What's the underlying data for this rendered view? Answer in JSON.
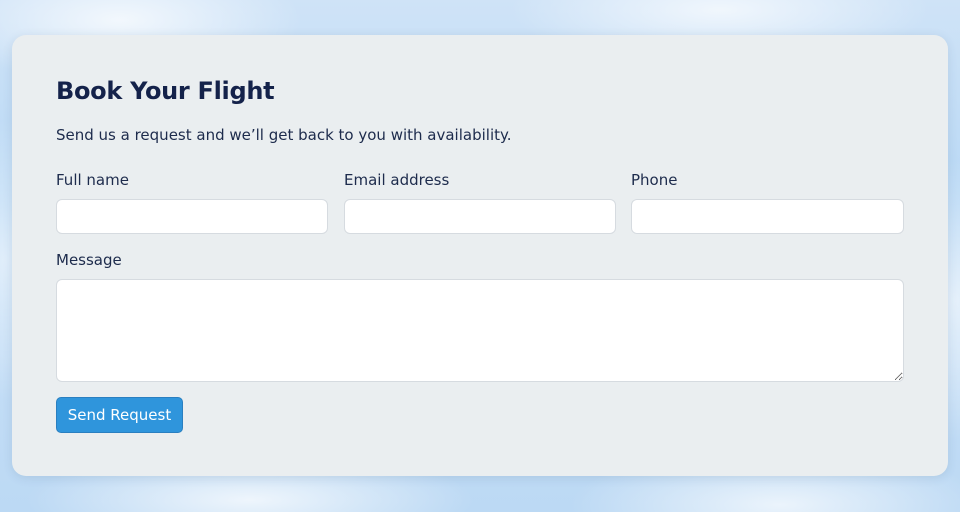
{
  "form": {
    "title": "Book Your Flight",
    "subtitle": "Send us a request and we’ll get back to you with availability.",
    "fields": {
      "full_name": {
        "label": "Full name",
        "value": "",
        "placeholder": ""
      },
      "email": {
        "label": "Email address",
        "value": "",
        "placeholder": ""
      },
      "phone": {
        "label": "Phone",
        "value": "",
        "placeholder": ""
      },
      "message": {
        "label": "Message",
        "value": "",
        "placeholder": ""
      }
    },
    "submit_label": "Send Request"
  },
  "colors": {
    "card_background": "#eaeef0",
    "title_text": "#14224a",
    "accent_button": "#2f95dc",
    "sky_background": "#c3ddf6"
  }
}
